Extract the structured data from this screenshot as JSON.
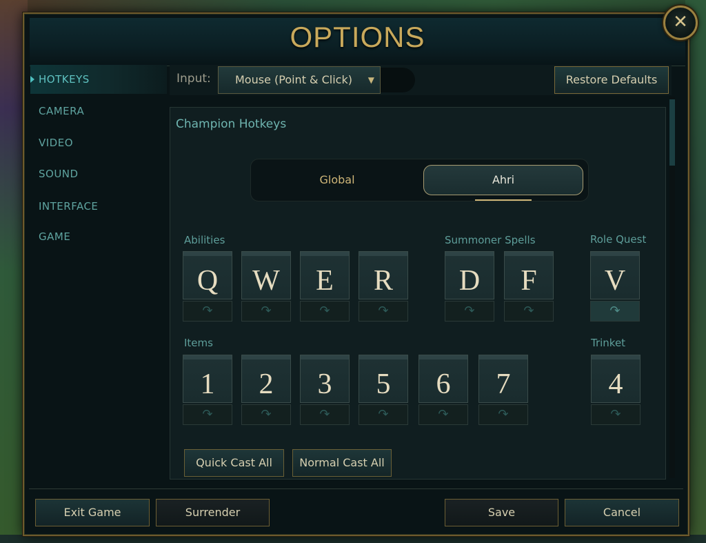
{
  "window": {
    "title": "OPTIONS",
    "close_glyph": "✕"
  },
  "sidebar": {
    "items": [
      {
        "label": "HOTKEYS",
        "active": true
      },
      {
        "label": "CAMERA"
      },
      {
        "label": "VIDEO"
      },
      {
        "label": "SOUND"
      },
      {
        "label": "INTERFACE"
      },
      {
        "label": "GAME"
      }
    ]
  },
  "input": {
    "label": "Input:",
    "selected": "Mouse (Point & Click)",
    "arrow": "▼"
  },
  "restore_defaults": "Restore Defaults",
  "champion_hotkeys": {
    "title": "Champion Hotkeys",
    "toggle": {
      "global": "Global",
      "champion": "Ahri",
      "selected": "Ahri"
    },
    "groups": {
      "abilities": "Abilities",
      "summoner_spells": "Summoner Spells",
      "role_quest": "Role Quest",
      "items": "Items",
      "trinket": "Trinket"
    },
    "ability_keys": [
      "Q",
      "W",
      "E",
      "R"
    ],
    "summoner_keys": [
      "D",
      "F"
    ],
    "role_quest_key": "V",
    "item_keys": [
      "1",
      "2",
      "3",
      "5",
      "6",
      "7"
    ],
    "trinket_key": "4",
    "quick_cast_glyph": "↷",
    "quick_cast_all": "Quick Cast All",
    "normal_cast_all": "Normal Cast All"
  },
  "footer": {
    "exit_game": "Exit Game",
    "surrender": "Surrender",
    "save": "Save",
    "cancel": "Cancel"
  },
  "colors": {
    "gold": "#c9a95b",
    "teal_text": "#5fa4a0",
    "panel_bg": "#091416"
  }
}
